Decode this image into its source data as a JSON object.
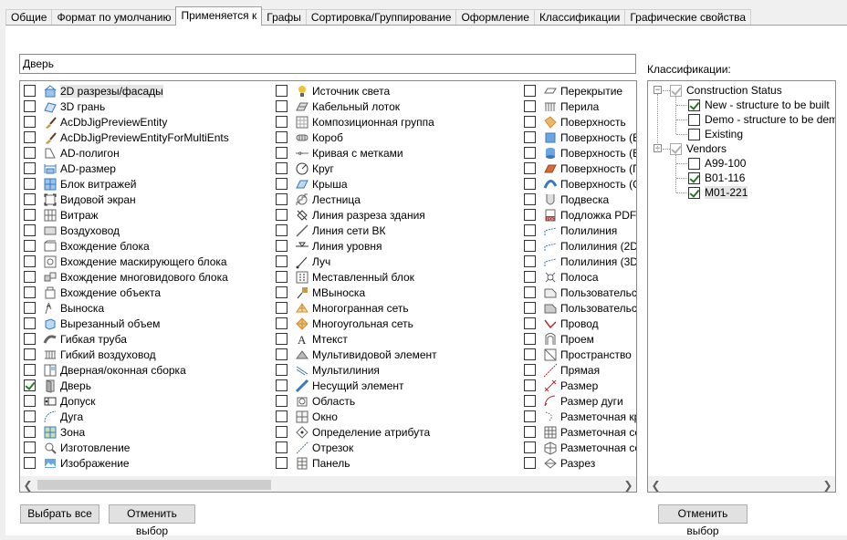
{
  "tabs": [
    {
      "label": "Общие",
      "active": false
    },
    {
      "label": "Формат по умолчанию",
      "active": false
    },
    {
      "label": "Применяется к",
      "active": true
    },
    {
      "label": "Графы",
      "active": false
    },
    {
      "label": "Сортировка/Группирование",
      "active": false
    },
    {
      "label": "Оформление",
      "active": false
    },
    {
      "label": "Классификации",
      "active": false
    },
    {
      "label": "Графические свойства",
      "active": false
    }
  ],
  "search": {
    "value": "Дверь"
  },
  "objects": {
    "col1": [
      {
        "label": "2D разрезы/фасады",
        "icon": "building-section-icon",
        "checked": false,
        "selected": true
      },
      {
        "label": "3D грань",
        "icon": "face-3d-icon",
        "checked": false
      },
      {
        "label": "AcDbJigPreviewEntity",
        "icon": "brush-icon",
        "checked": false
      },
      {
        "label": "AcDbJigPreviewEntityForMultiEnts",
        "icon": "brush-icon",
        "checked": false
      },
      {
        "label": "AD-полигон",
        "icon": "polygon-icon",
        "checked": false
      },
      {
        "label": "AD-размер",
        "icon": "dimension-icon",
        "checked": false
      },
      {
        "label": "Блок витражей",
        "icon": "curtain-block-icon",
        "checked": false
      },
      {
        "label": "Видовой экран",
        "icon": "viewport-icon",
        "checked": false
      },
      {
        "label": "Витраж",
        "icon": "curtain-wall-icon",
        "checked": false
      },
      {
        "label": "Воздуховод",
        "icon": "duct-icon",
        "checked": false
      },
      {
        "label": "Вхождение блока",
        "icon": "block-ref-icon",
        "checked": false
      },
      {
        "label": "Вхождение маскирующего блока",
        "icon": "mask-block-icon",
        "checked": false
      },
      {
        "label": "Вхождение многовидового блока",
        "icon": "multiview-block-icon",
        "checked": false
      },
      {
        "label": "Вхождение объекта",
        "icon": "object-ref-icon",
        "checked": false
      },
      {
        "label": "Выноска",
        "icon": "leader-icon",
        "checked": false
      },
      {
        "label": "Вырезанный объем",
        "icon": "cut-volume-icon",
        "checked": false
      },
      {
        "label": "Гибкая труба",
        "icon": "flex-pipe-icon",
        "checked": false
      },
      {
        "label": "Гибкий воздуховод",
        "icon": "flex-duct-icon",
        "checked": false
      },
      {
        "label": "Дверная/оконная сборка",
        "icon": "door-window-assembly-icon",
        "checked": false
      },
      {
        "label": "Дверь",
        "icon": "door-icon",
        "checked": true
      },
      {
        "label": "Допуск",
        "icon": "tolerance-icon",
        "checked": false
      },
      {
        "label": "Дуга",
        "icon": "arc-icon",
        "checked": false
      },
      {
        "label": "Зона",
        "icon": "zone-icon",
        "checked": false
      },
      {
        "label": "Изготовление",
        "icon": "fabrication-icon",
        "checked": false
      },
      {
        "label": "Изображение",
        "icon": "image-icon",
        "checked": false
      }
    ],
    "col2": [
      {
        "label": "Источник света",
        "icon": "light-bulb-icon",
        "checked": false
      },
      {
        "label": "Кабельный лоток",
        "icon": "cable-tray-icon",
        "checked": false
      },
      {
        "label": "Композиционная группа",
        "icon": "composition-group-icon",
        "checked": false
      },
      {
        "label": "Короб",
        "icon": "conduit-icon",
        "checked": false
      },
      {
        "label": "Кривая с метками",
        "icon": "marked-curve-icon",
        "checked": false
      },
      {
        "label": "Круг",
        "icon": "circle-icon",
        "checked": false
      },
      {
        "label": "Крыша",
        "icon": "roof-icon",
        "checked": false
      },
      {
        "label": "Лестница",
        "icon": "stair-icon",
        "checked": false
      },
      {
        "label": "Линия разреза здания",
        "icon": "section-line-icon",
        "checked": false
      },
      {
        "label": "Линия сети ВК",
        "icon": "grid-line-icon",
        "checked": false
      },
      {
        "label": "Линия уровня",
        "icon": "level-line-icon",
        "checked": false
      },
      {
        "label": "Луч",
        "icon": "ray-icon",
        "checked": false
      },
      {
        "label": "Меставленный блок",
        "icon": "inserted-block-icon",
        "checked": false
      },
      {
        "label": "МВыноска",
        "icon": "mleader-icon",
        "checked": false
      },
      {
        "label": "Многогранная сеть",
        "icon": "polyface-mesh-icon",
        "checked": false
      },
      {
        "label": "Многоугольная сеть",
        "icon": "polygon-mesh-icon",
        "checked": false
      },
      {
        "label": "Мтекст",
        "icon": "mtext-icon",
        "checked": false
      },
      {
        "label": "Мультивидовой элемент",
        "icon": "multiview-element-icon",
        "checked": false
      },
      {
        "label": "Мультилиния",
        "icon": "multiline-icon",
        "checked": false
      },
      {
        "label": "Несущий элемент",
        "icon": "structural-member-icon",
        "checked": false
      },
      {
        "label": "Область",
        "icon": "region-icon",
        "checked": false
      },
      {
        "label": "Окно",
        "icon": "window-icon",
        "checked": false
      },
      {
        "label": "Определение атрибута",
        "icon": "attribute-def-icon",
        "checked": false
      },
      {
        "label": "Отрезок",
        "icon": "line-icon",
        "checked": false
      },
      {
        "label": "Панель",
        "icon": "panel-icon",
        "checked": false
      }
    ],
    "col3": [
      {
        "label": "Перекрытие",
        "icon": "slab-icon",
        "checked": false
      },
      {
        "label": "Перила",
        "icon": "railing-icon",
        "checked": false
      },
      {
        "label": "Поверхность",
        "icon": "surface-icon",
        "checked": false
      },
      {
        "label": "Поверхность (Вь",
        "icon": "surface-extruded-icon",
        "checked": false
      },
      {
        "label": "Поверхность (Вр",
        "icon": "surface-revolved-icon",
        "checked": false
      },
      {
        "label": "Поверхность (П",
        "icon": "surface-planar-icon",
        "checked": false
      },
      {
        "label": "Поверхность (С,",
        "icon": "surface-swept-icon",
        "checked": false
      },
      {
        "label": "Подвеска",
        "icon": "hanger-icon",
        "checked": false
      },
      {
        "label": "Подложка PDF",
        "icon": "pdf-underlay-icon",
        "checked": false
      },
      {
        "label": "Полилиния",
        "icon": "polyline-icon",
        "checked": false
      },
      {
        "label": "Полилиния (2D)",
        "icon": "polyline-2d-icon",
        "checked": false
      },
      {
        "label": "Полилиния (3D)",
        "icon": "polyline-3d-icon",
        "checked": false
      },
      {
        "label": "Полоса",
        "icon": "strip-icon",
        "checked": false
      },
      {
        "label": "Пользовательск",
        "icon": "custom-icon",
        "checked": false
      },
      {
        "label": "Пользовательск",
        "icon": "custom2-icon",
        "checked": false
      },
      {
        "label": "Провод",
        "icon": "wire-icon",
        "checked": false
      },
      {
        "label": "Проем",
        "icon": "opening-icon",
        "checked": false
      },
      {
        "label": "Пространство",
        "icon": "space-icon",
        "checked": false
      },
      {
        "label": "Прямая",
        "icon": "xline-icon",
        "checked": false
      },
      {
        "label": "Размер",
        "icon": "dim-icon",
        "checked": false
      },
      {
        "label": "Размер дуги",
        "icon": "arc-dim-icon",
        "checked": false
      },
      {
        "label": "Разметочная кр",
        "icon": "layout-curve-icon",
        "checked": false
      },
      {
        "label": "Разметочная сет",
        "icon": "layout-grid-icon",
        "checked": false
      },
      {
        "label": "Разметочная сет",
        "icon": "layout-grid3d-icon",
        "checked": false
      },
      {
        "label": "Разрез",
        "icon": "section-icon",
        "checked": false
      }
    ]
  },
  "classifications": {
    "label": "Классификации:",
    "groups": [
      {
        "label": "Construction Status",
        "checked": true,
        "items": [
          {
            "label": "New - structure to be built",
            "checked": true
          },
          {
            "label": "Demo - structure to be demolis",
            "checked": false
          },
          {
            "label": "Existing",
            "checked": false
          }
        ]
      },
      {
        "label": "Vendors",
        "checked": true,
        "items": [
          {
            "label": "A99-100",
            "checked": false
          },
          {
            "label": "B01-116",
            "checked": true
          },
          {
            "label": "M01-221",
            "checked": true,
            "selected": true
          }
        ]
      }
    ]
  },
  "buttons": {
    "select_all": "Выбрать все",
    "clear_left": "Отменить выбор",
    "clear_right": "Отменить выбор"
  }
}
